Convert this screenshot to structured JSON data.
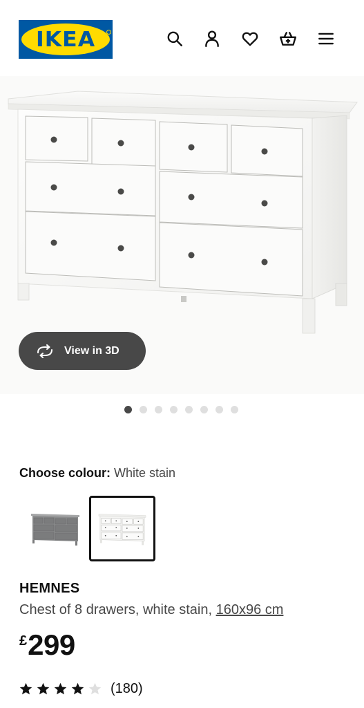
{
  "brand": {
    "logo_text": "IKEA"
  },
  "header": {
    "icons": [
      "search-icon",
      "profile-icon",
      "heart-icon",
      "basket-icon",
      "menu-icon"
    ]
  },
  "gallery": {
    "view_3d_label": "View in 3D",
    "image_count": 8,
    "active_index": 0
  },
  "colour": {
    "label": "Choose colour:",
    "selected": "White stain",
    "options": [
      "Grey stain",
      "White stain"
    ]
  },
  "product": {
    "name": "HEMNES",
    "description": "Chest of 8 drawers, white stain,",
    "size_link": "160x96 cm",
    "currency": "£",
    "price": "299",
    "rating": 4,
    "rating_max": 5,
    "review_count": "(180)"
  },
  "colors": {
    "ikea_blue": "#0058a3",
    "ikea_yellow": "#ffdb00",
    "button_dark": "#484848"
  }
}
